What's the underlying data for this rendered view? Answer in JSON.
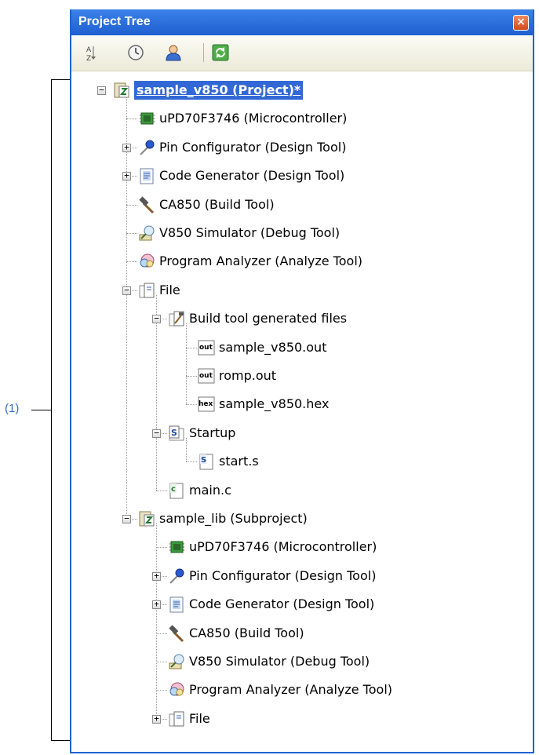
{
  "window": {
    "title": "Project Tree"
  },
  "toolbar": {
    "items": [
      {
        "icon": "sort-icon",
        "label": "Sort"
      },
      {
        "icon": "clock-icon",
        "label": "History"
      },
      {
        "icon": "user-icon",
        "label": "Properties"
      },
      {
        "icon": "refresh-icon",
        "label": "Refresh"
      }
    ]
  },
  "callout": {
    "label": "(1)"
  },
  "tree": [
    {
      "level": 0,
      "expander": "minus",
      "icon": "project",
      "label": "sample_v850 (Project)*",
      "selected": true
    },
    {
      "level": 1,
      "expander": "",
      "icon": "chip",
      "label": "uPD70F3746 (Microcontroller)"
    },
    {
      "level": 1,
      "expander": "plus",
      "icon": "pin",
      "label": "Pin Configurator (Design Tool)"
    },
    {
      "level": 1,
      "expander": "plus",
      "icon": "codegen",
      "label": "Code Generator (Design Tool)"
    },
    {
      "level": 1,
      "expander": "",
      "icon": "hammer",
      "label": "CA850 (Build Tool)"
    },
    {
      "level": 1,
      "expander": "",
      "icon": "simulator",
      "label": "V850 Simulator (Debug Tool)"
    },
    {
      "level": 1,
      "expander": "",
      "icon": "analyzer",
      "label": "Program Analyzer (Analyze Tool)"
    },
    {
      "level": 1,
      "expander": "minus",
      "icon": "folder",
      "label": "File"
    },
    {
      "level": 2,
      "expander": "minus",
      "icon": "buildfolder",
      "label": "Build tool generated files"
    },
    {
      "level": 3,
      "expander": "",
      "icon": "out",
      "label": "sample_v850.out"
    },
    {
      "level": 3,
      "expander": "",
      "icon": "out",
      "label": "romp.out"
    },
    {
      "level": 3,
      "expander": "",
      "icon": "hex",
      "label": "sample_v850.hex"
    },
    {
      "level": 2,
      "expander": "minus",
      "icon": "sfolder",
      "label": "Startup"
    },
    {
      "level": 3,
      "expander": "",
      "icon": "sfile",
      "label": "start.s"
    },
    {
      "level": 2,
      "expander": "",
      "icon": "cfile",
      "label": "main.c"
    },
    {
      "level": 1,
      "expander": "minus",
      "icon": "project",
      "label": "sample_lib (Subproject)"
    },
    {
      "level": 2,
      "expander": "",
      "icon": "chip",
      "label": "uPD70F3746 (Microcontroller)"
    },
    {
      "level": 2,
      "expander": "plus",
      "icon": "pin",
      "label": "Pin Configurator (Design Tool)"
    },
    {
      "level": 2,
      "expander": "plus",
      "icon": "codegen",
      "label": "Code Generator (Design Tool)"
    },
    {
      "level": 2,
      "expander": "",
      "icon": "hammer",
      "label": "CA850 (Build Tool)"
    },
    {
      "level": 2,
      "expander": "",
      "icon": "simulator",
      "label": "V850 Simulator (Debug Tool)"
    },
    {
      "level": 2,
      "expander": "",
      "icon": "analyzer",
      "label": "Program Analyzer (Analyze Tool)"
    },
    {
      "level": 2,
      "expander": "plus",
      "icon": "folder",
      "label": "File"
    }
  ]
}
